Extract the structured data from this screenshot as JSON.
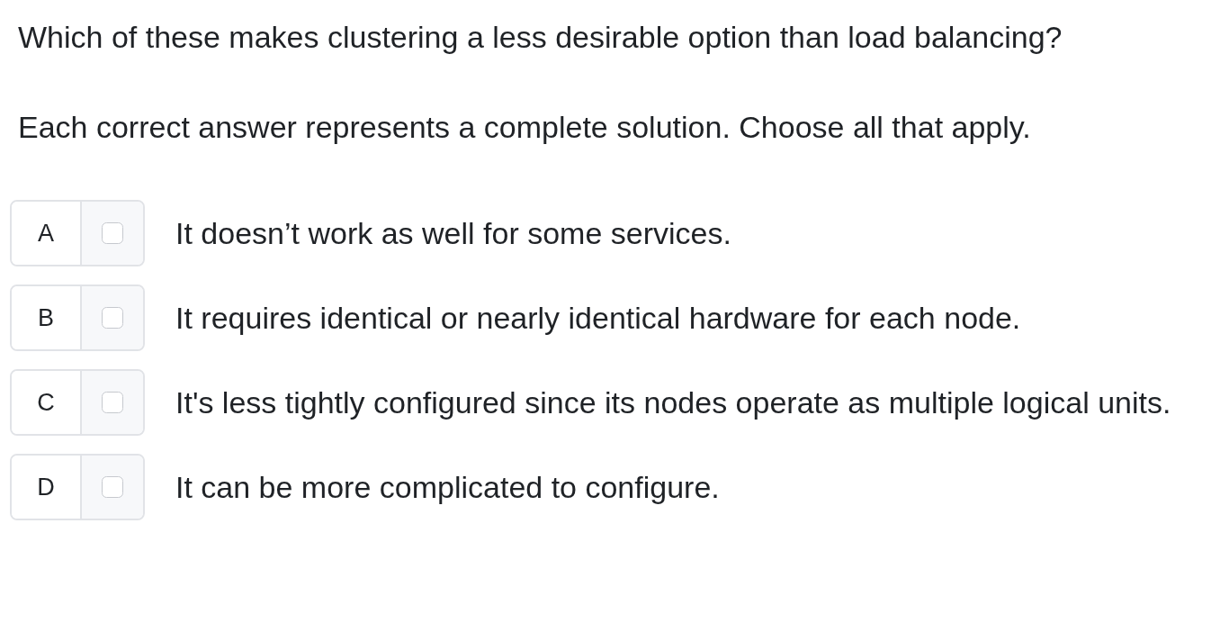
{
  "question": "Which of these makes clustering a less desirable option than load balancing?",
  "instructions": "Each correct answer represents a complete solution. Choose all that apply.",
  "options": [
    {
      "letter": "A",
      "checked": false,
      "text": "It doesn’t work as well for some services."
    },
    {
      "letter": "B",
      "checked": false,
      "text": "It requires identical or nearly identical hardware for each node."
    },
    {
      "letter": "C",
      "checked": false,
      "text": "It's less tightly configured since its nodes operate as multiple logical units."
    },
    {
      "letter": "D",
      "checked": false,
      "text": "It can be more complicated to configure."
    }
  ]
}
